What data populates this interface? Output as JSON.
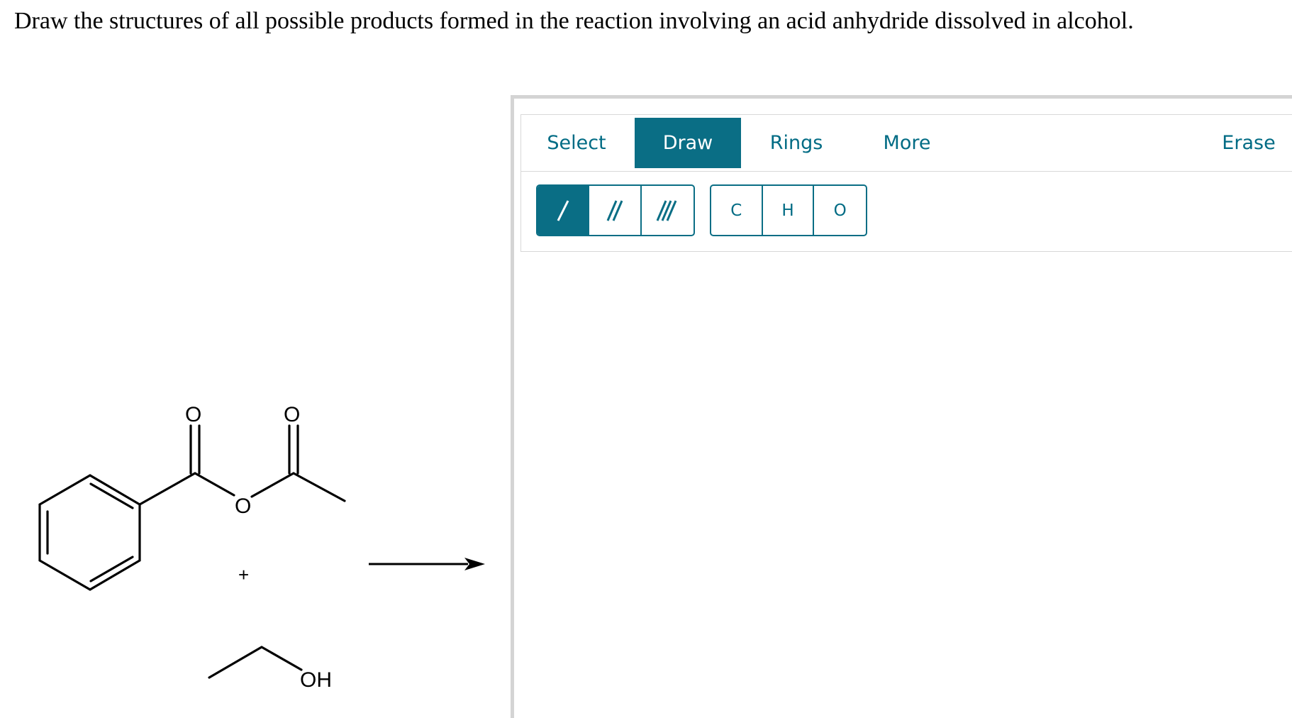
{
  "question": {
    "text": "Draw the structures of all possible products formed in the reaction involving an acid anhydride dissolved in alcohol."
  },
  "reaction": {
    "reactant1": {
      "atom_labels": [
        "O",
        "O",
        "O"
      ]
    },
    "plus_sign": "+",
    "reactant2": {
      "label": "OH"
    },
    "arrow_icon": "reaction-arrow-icon"
  },
  "editor": {
    "tabs": [
      {
        "label": "Select",
        "active": false
      },
      {
        "label": "Draw",
        "active": true
      },
      {
        "label": "Rings",
        "active": false
      },
      {
        "label": "More",
        "active": false
      },
      {
        "label": "Erase",
        "active": false
      }
    ],
    "bond_tools": [
      {
        "icon": "single-bond-icon",
        "selected": true
      },
      {
        "icon": "double-bond-icon",
        "selected": false
      },
      {
        "icon": "triple-bond-icon",
        "selected": false
      }
    ],
    "atom_tools": [
      "C",
      "H",
      "O"
    ],
    "accent_color": "#0a6e85",
    "text_color": "#006b84"
  }
}
